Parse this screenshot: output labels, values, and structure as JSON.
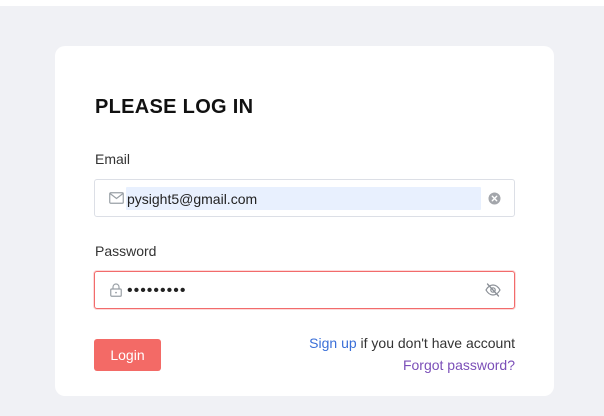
{
  "colors": {
    "page_background": "#f0f1f5",
    "card_background": "#ffffff",
    "login_button": "#f36a66",
    "signup_link": "#3a6fd8",
    "forgot_link": "#7b4fb8",
    "error_border": "#f26b6b",
    "autofill_highlight": "#e8f0fe"
  },
  "form": {
    "title": "PLEASE LOG IN",
    "email": {
      "label": "Email",
      "value": "pysight5@gmail.com",
      "icon": "envelope-icon",
      "trailing_icon": "clear-icon"
    },
    "password": {
      "label": "Password",
      "value": "•••••••••",
      "icon": "lock-icon",
      "trailing_icon": "eye-slash-icon"
    },
    "login_label": "Login",
    "signup_link": "Sign up",
    "signup_suffix": " if you don't have account",
    "forgot_link": "Forgot password?"
  }
}
